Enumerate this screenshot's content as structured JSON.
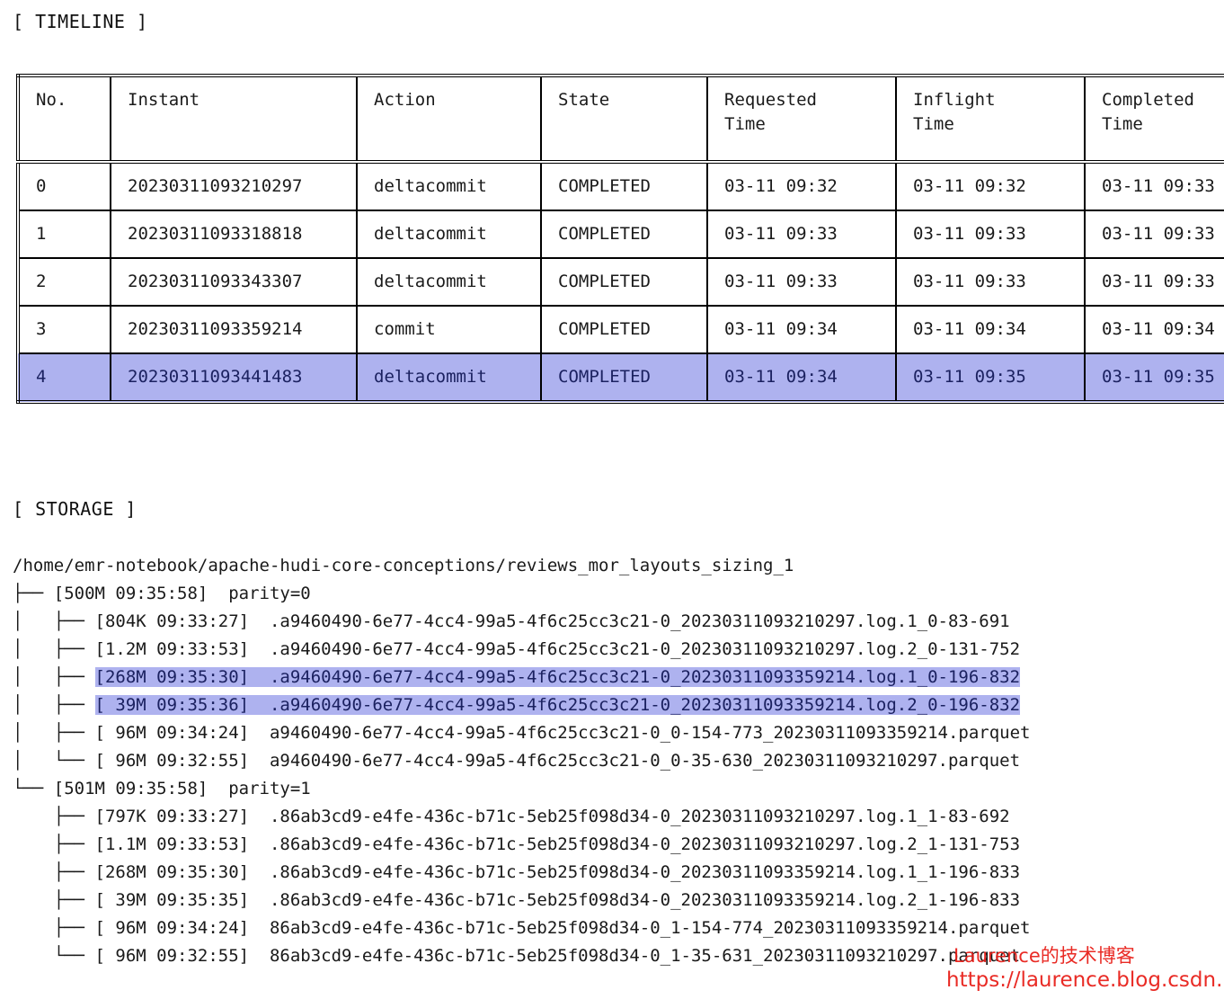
{
  "sections": {
    "timeline_label": "[ TIMELINE ]",
    "storage_label": "[ STORAGE ]"
  },
  "colors": {
    "highlight_bg": "#aeb2ef",
    "highlight_fg": "#1b2160",
    "watermark": "#e8201a",
    "text": "#1a1a1a",
    "border": "#000000"
  },
  "timeline": {
    "columns": [
      {
        "line1": "No.",
        "line2": ""
      },
      {
        "line1": "Instant",
        "line2": ""
      },
      {
        "line1": "Action",
        "line2": ""
      },
      {
        "line1": "State",
        "line2": ""
      },
      {
        "line1": "Requested",
        "line2": "Time"
      },
      {
        "line1": "Inflight",
        "line2": "Time"
      },
      {
        "line1": "Completed",
        "line2": "Time"
      }
    ],
    "rows": [
      {
        "no": "0",
        "instant": "20230311093210297",
        "action": "deltacommit",
        "state": "COMPLETED",
        "requested_time": "03-11 09:32",
        "inflight_time": "03-11 09:32",
        "completed_time": "03-11 09:33",
        "highlighted": false
      },
      {
        "no": "1",
        "instant": "20230311093318818",
        "action": "deltacommit",
        "state": "COMPLETED",
        "requested_time": "03-11 09:33",
        "inflight_time": "03-11 09:33",
        "completed_time": "03-11 09:33",
        "highlighted": false
      },
      {
        "no": "2",
        "instant": "20230311093343307",
        "action": "deltacommit",
        "state": "COMPLETED",
        "requested_time": "03-11 09:33",
        "inflight_time": "03-11 09:33",
        "completed_time": "03-11 09:33",
        "highlighted": false
      },
      {
        "no": "3",
        "instant": "20230311093359214",
        "action": "commit",
        "state": "COMPLETED",
        "requested_time": "03-11 09:34",
        "inflight_time": "03-11 09:34",
        "completed_time": "03-11 09:34",
        "highlighted": false
      },
      {
        "no": "4",
        "instant": "20230311093441483",
        "action": "deltacommit",
        "state": "COMPLETED",
        "requested_time": "03-11 09:34",
        "inflight_time": "03-11 09:35",
        "completed_time": "03-11 09:35",
        "highlighted": true
      }
    ]
  },
  "storage": {
    "root_path": "/home/emr-notebook/apache-hudi-core-conceptions/reviews_mor_layouts_sizing_1",
    "lines": [
      {
        "prefix": "",
        "text": "/home/emr-notebook/apache-hudi-core-conceptions/reviews_mor_layouts_sizing_1",
        "highlighted": false
      },
      {
        "prefix": "├── ",
        "text": "[500M 09:35:58]  parity=0",
        "highlighted": false
      },
      {
        "prefix": "│   ├── ",
        "text": "[804K 09:33:27]  .a9460490-6e77-4cc4-99a5-4f6c25cc3c21-0_20230311093210297.log.1_0-83-691",
        "highlighted": false
      },
      {
        "prefix": "│   ├── ",
        "text": "[1.2M 09:33:53]  .a9460490-6e77-4cc4-99a5-4f6c25cc3c21-0_20230311093210297.log.2_0-131-752",
        "highlighted": false
      },
      {
        "prefix": "│   ├── ",
        "text": "[268M 09:35:30]  .a9460490-6e77-4cc4-99a5-4f6c25cc3c21-0_20230311093359214.log.1_0-196-832",
        "highlighted": true
      },
      {
        "prefix": "│   ├── ",
        "text": "[ 39M 09:35:36]  .a9460490-6e77-4cc4-99a5-4f6c25cc3c21-0_20230311093359214.log.2_0-196-832",
        "highlighted": true
      },
      {
        "prefix": "│   ├── ",
        "text": "[ 96M 09:34:24]  a9460490-6e77-4cc4-99a5-4f6c25cc3c21-0_0-154-773_20230311093359214.parquet",
        "highlighted": false
      },
      {
        "prefix": "│   └── ",
        "text": "[ 96M 09:32:55]  a9460490-6e77-4cc4-99a5-4f6c25cc3c21-0_0-35-630_20230311093210297.parquet",
        "highlighted": false
      },
      {
        "prefix": "└── ",
        "text": "[501M 09:35:58]  parity=1",
        "highlighted": false
      },
      {
        "prefix": "    ├── ",
        "text": "[797K 09:33:27]  .86ab3cd9-e4fe-436c-b71c-5eb25f098d34-0_20230311093210297.log.1_1-83-692",
        "highlighted": false
      },
      {
        "prefix": "    ├── ",
        "text": "[1.1M 09:33:53]  .86ab3cd9-e4fe-436c-b71c-5eb25f098d34-0_20230311093210297.log.2_1-131-753",
        "highlighted": false
      },
      {
        "prefix": "    ├── ",
        "text": "[268M 09:35:30]  .86ab3cd9-e4fe-436c-b71c-5eb25f098d34-0_20230311093359214.log.1_1-196-833",
        "highlighted": false
      },
      {
        "prefix": "    ├── ",
        "text": "[ 39M 09:35:35]  .86ab3cd9-e4fe-436c-b71c-5eb25f098d34-0_20230311093359214.log.2_1-196-833",
        "highlighted": false
      },
      {
        "prefix": "    ├── ",
        "text": "[ 96M 09:34:24]  86ab3cd9-e4fe-436c-b71c-5eb25f098d34-0_1-154-774_20230311093359214.parquet",
        "highlighted": false
      },
      {
        "prefix": "    └── ",
        "text": "[ 96M 09:32:55]  86ab3cd9-e4fe-436c-b71c-5eb25f098d34-0_1-35-631_20230311093210297.parquet",
        "highlighted": false
      }
    ]
  },
  "watermark": {
    "title": "Laurence的技术博客",
    "url": "https://laurence.blog.csdn.net"
  }
}
